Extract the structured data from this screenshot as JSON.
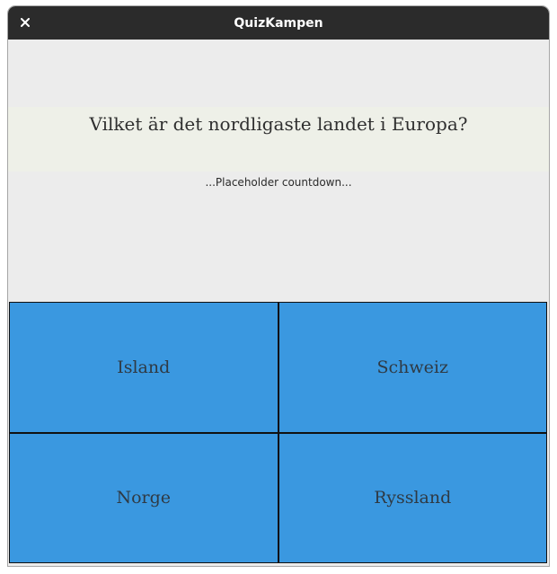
{
  "window": {
    "title": "QuizKampen",
    "close_icon": "close-icon"
  },
  "question": {
    "text": "Vilket är det nordligaste landet i Europa?"
  },
  "countdown": {
    "text": "...Placeholder countdown..."
  },
  "answers": [
    {
      "label": "Island"
    },
    {
      "label": "Schweiz"
    },
    {
      "label": "Norge"
    },
    {
      "label": "Ryssland"
    }
  ],
  "colors": {
    "titlebar": "#2b2b2b",
    "background": "#ececec",
    "answer_button": "#3a98e0",
    "question_band": "#eef0e8"
  }
}
